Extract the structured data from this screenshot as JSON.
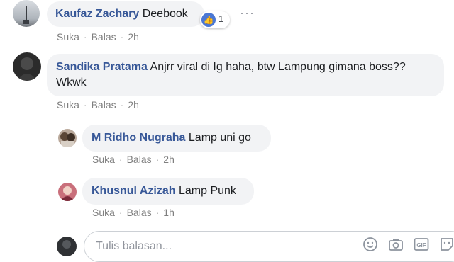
{
  "colors": {
    "name": "#385898",
    "bubble": "#f2f3f5",
    "like": "#4a77d4",
    "meta": "#7f7f7f"
  },
  "comments": [
    {
      "author": "Kaufaz Zachary",
      "text": "Deebook",
      "actions": {
        "like": "Suka",
        "reply": "Balas",
        "time": "2h"
      },
      "reaction": {
        "icon": "like-icon",
        "count": "1"
      }
    },
    {
      "author": "Sandika Pratama",
      "text_line1": "Anjrr viral di Ig haha, btw Lampung gimana boss??",
      "text_line2": "Wkwk",
      "actions": {
        "like": "Suka",
        "reply": "Balas",
        "time": "2h"
      }
    }
  ],
  "replies": [
    {
      "author": "M Ridho Nugraha",
      "text": "Lamp uni go",
      "actions": {
        "like": "Suka",
        "reply": "Balas",
        "time": "2h"
      }
    },
    {
      "author": "Khusnul Azizah",
      "text": "Lamp Punk",
      "actions": {
        "like": "Suka",
        "reply": "Balas",
        "time": "1h"
      }
    }
  ],
  "more_glyph": "···",
  "separator": "·",
  "reply_box": {
    "placeholder": "Tulis balasan..."
  },
  "icons": [
    "smiley-icon",
    "camera-icon",
    "gif-icon",
    "sticker-icon"
  ]
}
